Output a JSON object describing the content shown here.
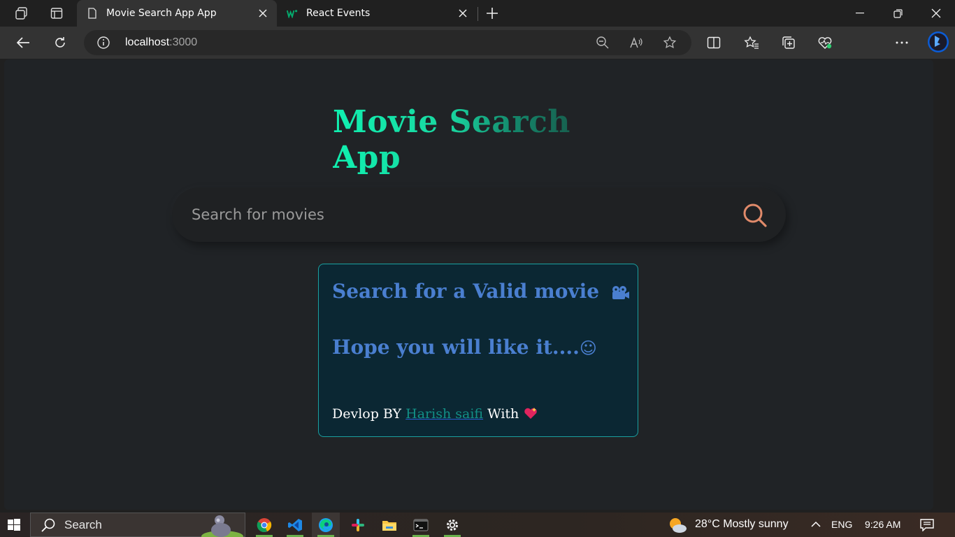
{
  "browser": {
    "tabs": [
      {
        "title": "Movie Search App App",
        "active": true
      },
      {
        "title": "React Events",
        "active": false
      }
    ],
    "address": {
      "host": "localhost",
      "port": ":3000"
    }
  },
  "app": {
    "title": "Movie Search App",
    "search": {
      "placeholder": "Search for movies",
      "value": ""
    },
    "card": {
      "line1": "Search for a Valid movie",
      "line2": "Hope you will like it....",
      "line2_emoji": "☺",
      "footer_prefix": "Devlop BY",
      "author": "Harish saifi",
      "footer_suffix": "With",
      "footer_emoji": "💖"
    },
    "colors": {
      "title_gradient_start": "#10f0b0",
      "card_text": "#4a7fd0",
      "card_border": "#1aa0a0",
      "search_icon": "#e08a6a"
    }
  },
  "taskbar": {
    "search_label": "Search",
    "weather": "28°C  Mostly sunny",
    "language": "ENG",
    "time": "9:26 AM"
  }
}
